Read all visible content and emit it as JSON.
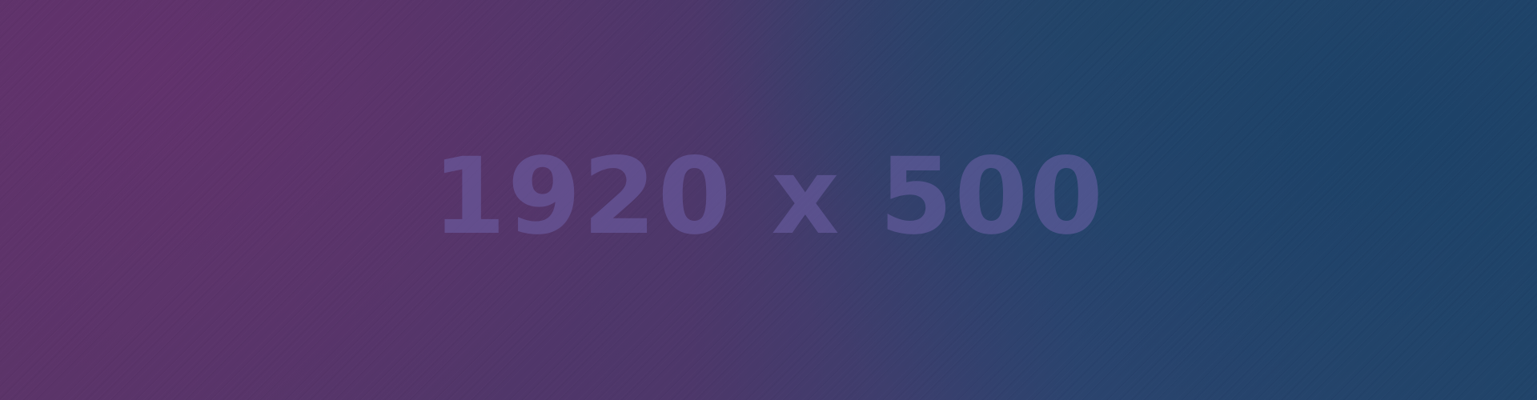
{
  "placeholder": {
    "label": "1920 x 500",
    "colors": {
      "purple": "#5a3468",
      "blue": "#23456a",
      "text": "#7062aa"
    }
  }
}
